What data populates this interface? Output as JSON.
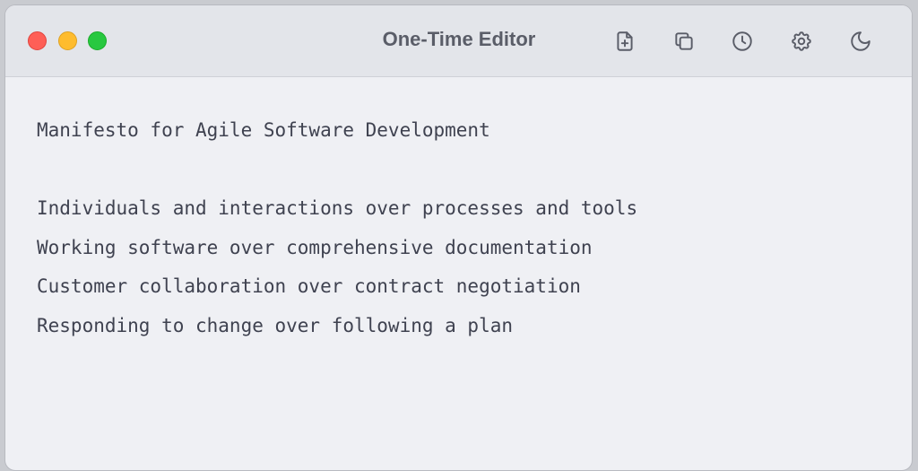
{
  "window": {
    "title": "One-Time Editor"
  },
  "toolbar": {
    "buttons": [
      {
        "name": "new-document",
        "icon": "file-plus-icon"
      },
      {
        "name": "copy",
        "icon": "copy-icon"
      },
      {
        "name": "history",
        "icon": "clock-icon"
      },
      {
        "name": "settings",
        "icon": "gear-icon"
      },
      {
        "name": "dark-mode",
        "icon": "moon-icon"
      }
    ]
  },
  "editor": {
    "lines": [
      "Manifesto for Agile Software Development",
      "",
      "Individuals and interactions over processes and tools",
      "Working software over comprehensive documentation",
      "Customer collaboration over contract negotiation",
      "Responding to change over following a plan"
    ]
  },
  "colors": {
    "close": "#fe5f57",
    "minimize": "#febc2e",
    "maximize": "#28c840",
    "text": "#3f4250",
    "icon": "#5a5d68"
  }
}
